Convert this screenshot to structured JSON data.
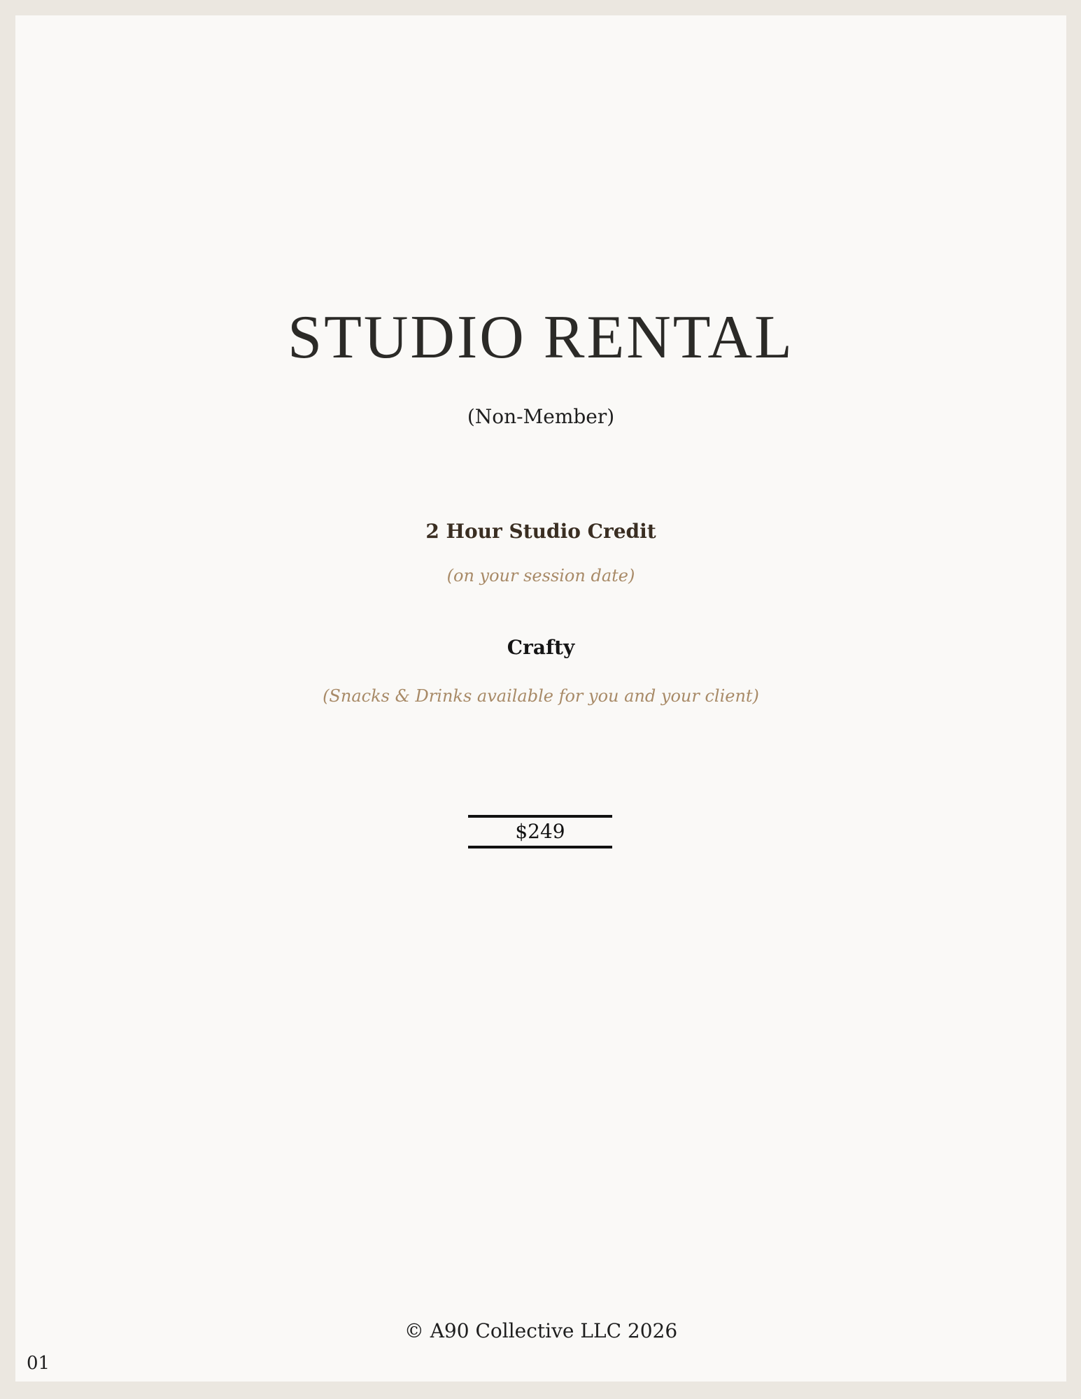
{
  "document": {
    "title": "STUDIO RENTAL",
    "subtitle": "(Non-Member)",
    "items": [
      {
        "title": "2 Hour Studio Credit",
        "note": "(on your session date)"
      },
      {
        "title": "Crafty",
        "note": "(Snacks & Drinks available for you and your client)"
      }
    ],
    "price": "$249",
    "footer": "© A90 Collective LLC 2026",
    "page_number": "01"
  },
  "colors": {
    "background": "#ebe7e0",
    "page": "#faf9f7",
    "title": "#2b2a27",
    "accent_note": "#a88a67",
    "credit_title": "#3a2e22",
    "rule": "#111111"
  }
}
